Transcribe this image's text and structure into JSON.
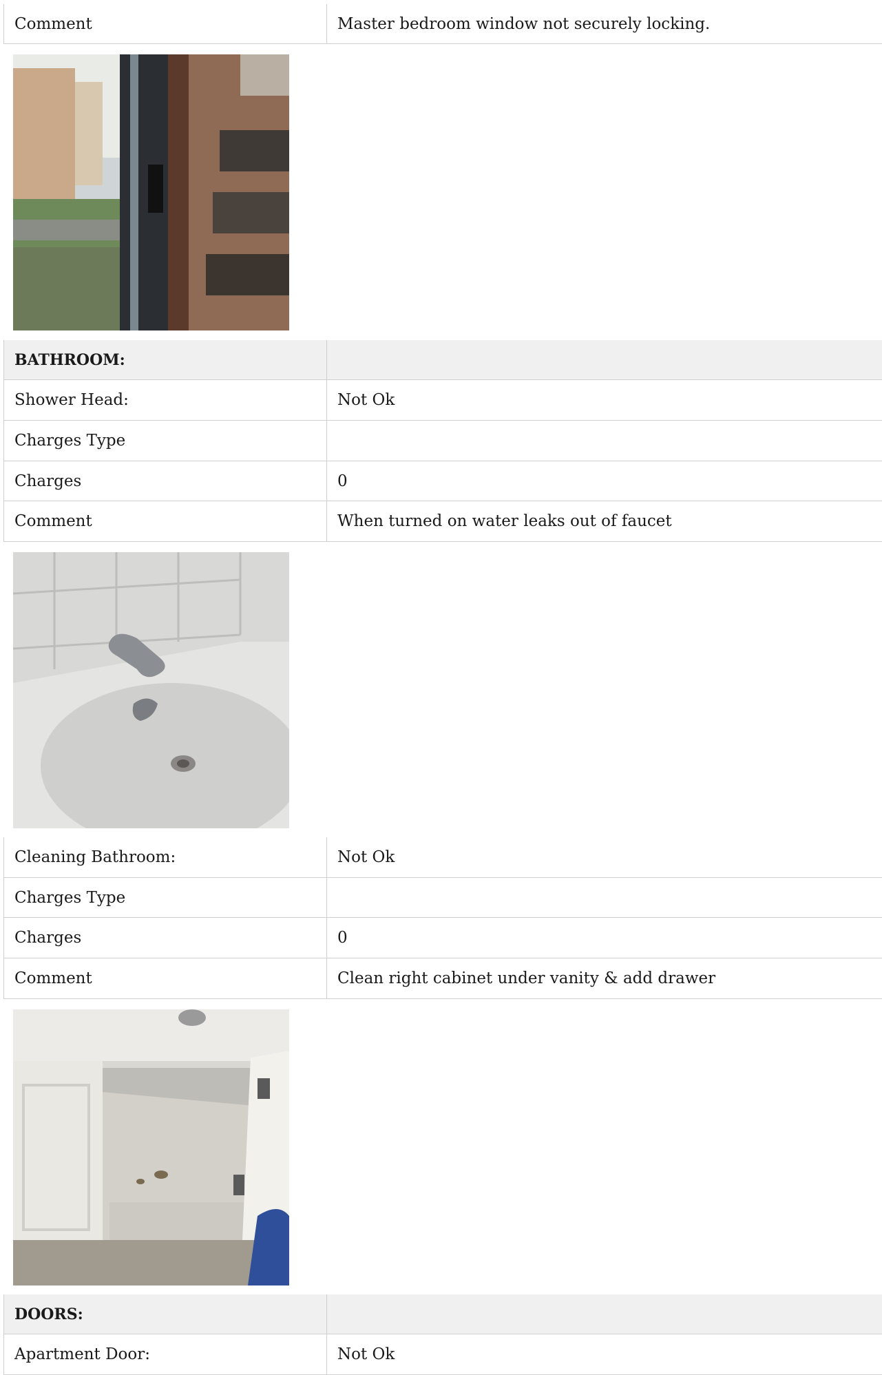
{
  "rows_top": [
    {
      "label": "Comment",
      "value": "Master bedroom window not securely locking."
    }
  ],
  "bathroom": {
    "heading": "BATHROOM:",
    "shower": [
      {
        "label": "Shower Head:",
        "value": "Not Ok"
      },
      {
        "label": "Charges Type",
        "value": ""
      },
      {
        "label": "Charges",
        "value": "0"
      },
      {
        "label": "Comment",
        "value": "When turned on water leaks out of faucet"
      }
    ],
    "cleaning": [
      {
        "label": "Cleaning Bathroom:",
        "value": "Not Ok"
      },
      {
        "label": "Charges Type",
        "value": ""
      },
      {
        "label": "Charges",
        "value": "0"
      },
      {
        "label": "Comment",
        "value": "Clean right cabinet under vanity & add drawer"
      }
    ]
  },
  "doors": {
    "heading": "DOORS:",
    "rows": [
      {
        "label": "Apartment Door:",
        "value": "Not Ok"
      }
    ]
  },
  "photos": {
    "window": "window-photo",
    "bathtub": "bathtub-photo",
    "cabinet": "cabinet-photo"
  }
}
